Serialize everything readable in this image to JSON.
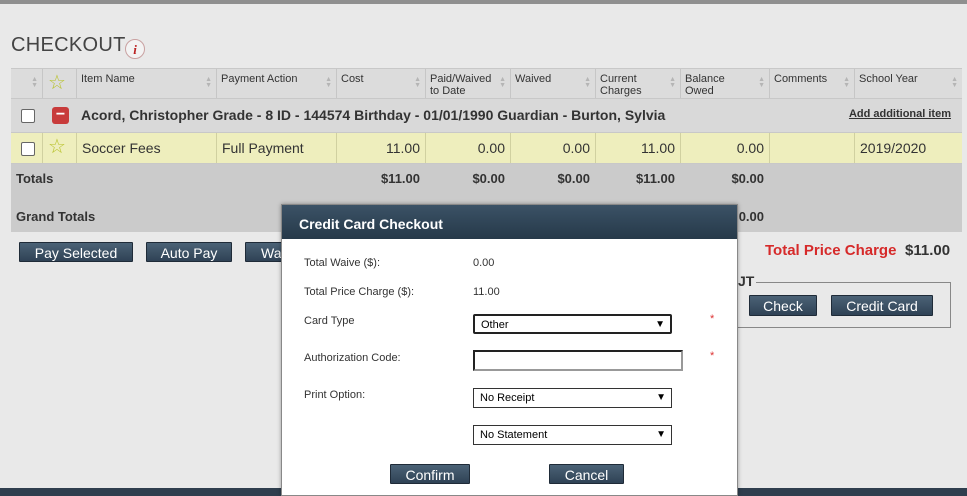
{
  "page": {
    "title": "CHECKOUT",
    "info_icon": "i"
  },
  "columns": [
    "Item Name",
    "Payment Action",
    "Cost",
    "Paid/Waived to Date",
    "Waived",
    "Current Charges",
    "Balance Owed",
    "Comments",
    "School Year"
  ],
  "student": {
    "summary": "Acord, Christopher Grade - 8 ID - 144574 Birthday - 01/01/1990 Guardian - Burton, Sylvia",
    "add_link": "Add additional item"
  },
  "item": {
    "name": "Soccer Fees",
    "action": "Full Payment",
    "cost": "11.00",
    "paid": "0.00",
    "waived": "0.00",
    "current": "11.00",
    "balance": "0.00",
    "comments": "",
    "year": "2019/2020"
  },
  "totals": {
    "label": "Totals",
    "cost": "$11.00",
    "paid": "$0.00",
    "waived": "$0.00",
    "current": "$11.00",
    "balance": "$0.00"
  },
  "grand_totals": {
    "label": "Grand Totals",
    "balance": "0.00"
  },
  "buttons": {
    "pay_selected": "Pay Selected",
    "auto_pay": "Auto Pay",
    "waive_partial": "Wa"
  },
  "total_price": {
    "label": "Total Price Charge",
    "value": "$11.00"
  },
  "checkout_box": {
    "legend": "JT",
    "check": "Check",
    "credit_card": "Credit Card"
  },
  "modal": {
    "title": "Credit Card Checkout",
    "total_waive_label": "Total Waive ($):",
    "total_waive": "0.00",
    "total_price_label": "Total Price Charge ($):",
    "total_price": "11.00",
    "card_type_label": "Card Type",
    "card_type": "Other",
    "auth_label": "Authorization Code:",
    "auth_value": "",
    "print_label": "Print Option:",
    "print_option": "No Receipt",
    "statement_option": "No Statement",
    "required_mark": "*",
    "confirm": "Confirm",
    "cancel": "Cancel"
  },
  "colors": {
    "accent_red": "#d62a2a",
    "button_dark": "#34495c",
    "item_row": "#eeeebd"
  },
  "icons": [
    "info-icon",
    "star-icon",
    "minus-icon",
    "sort-icon",
    "chevron-down-icon"
  ]
}
